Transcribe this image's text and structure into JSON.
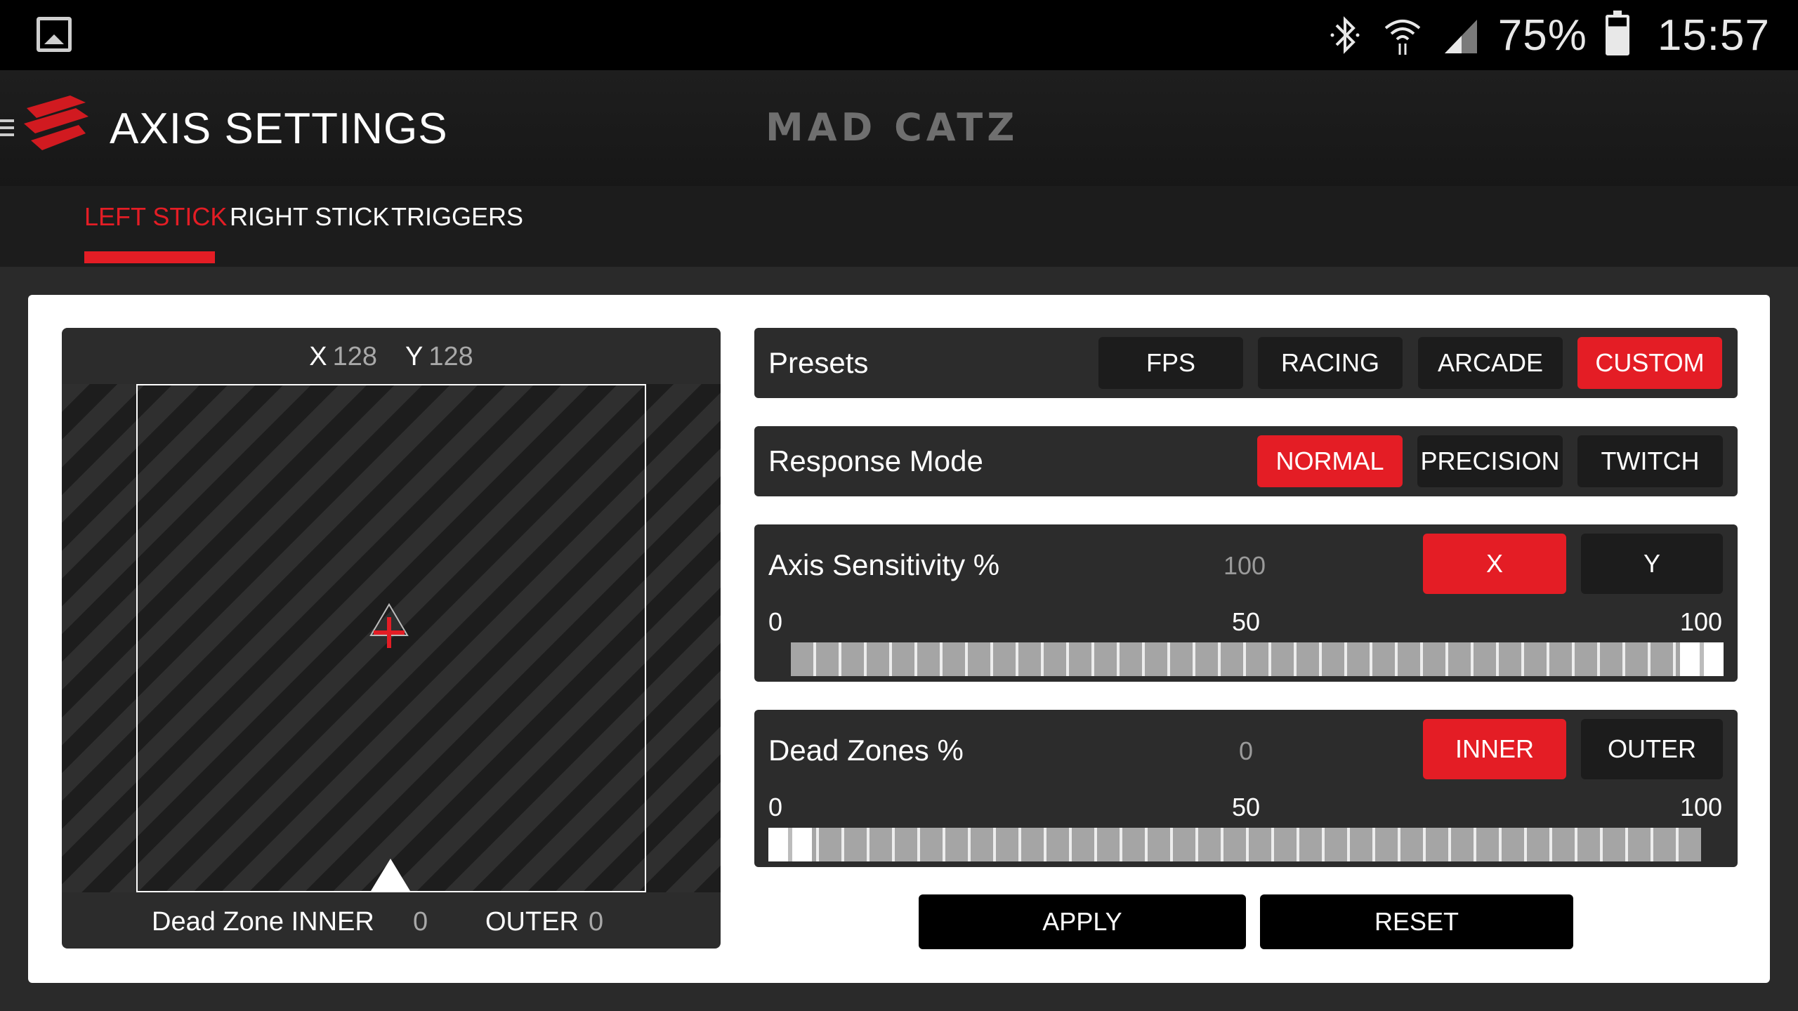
{
  "status_bar": {
    "battery_percent": "75%",
    "time": "15:57",
    "icons": [
      "gallery-icon",
      "bluetooth-icon",
      "wifi-icon",
      "signal-icon",
      "battery-icon"
    ]
  },
  "header": {
    "title": "AXIS SETTINGS",
    "brand": "MAD CATZ"
  },
  "tabs": [
    {
      "label": "LEFT STICK",
      "active": true
    },
    {
      "label": "RIGHT STICK",
      "active": false
    },
    {
      "label": "TRIGGERS",
      "active": false
    }
  ],
  "stick_preview": {
    "x_label": "X",
    "x_value": "128",
    "y_label": "Y",
    "y_value": "128",
    "dead_zone_inner_label": "Dead Zone INNER",
    "dead_zone_inner_value": "0",
    "dead_zone_outer_label": "OUTER",
    "dead_zone_outer_value": "0"
  },
  "presets": {
    "label": "Presets",
    "options": [
      "FPS",
      "RACING",
      "ARCADE",
      "CUSTOM"
    ],
    "selected": "CUSTOM"
  },
  "response_mode": {
    "label": "Response Mode",
    "options": [
      "NORMAL",
      "PRECISION",
      "TWITCH"
    ],
    "selected": "NORMAL"
  },
  "axis_sensitivity": {
    "label": "Axis Sensitivity %",
    "value": "100",
    "axis_options": [
      "X",
      "Y"
    ],
    "selected_axis": "X",
    "scale": {
      "min": "0",
      "mid": "50",
      "max": "100"
    },
    "slider_value": 100
  },
  "dead_zones": {
    "label": "Dead Zones %",
    "value": "0",
    "zone_options": [
      "INNER",
      "OUTER"
    ],
    "selected_zone": "INNER",
    "scale": {
      "min": "0",
      "mid": "50",
      "max": "100"
    },
    "slider_value": 0
  },
  "actions": {
    "apply_label": "APPLY",
    "reset_label": "RESET"
  },
  "colors": {
    "accent": "#e41d25",
    "panel": "#2c2c2c",
    "background": "#ffffff"
  }
}
